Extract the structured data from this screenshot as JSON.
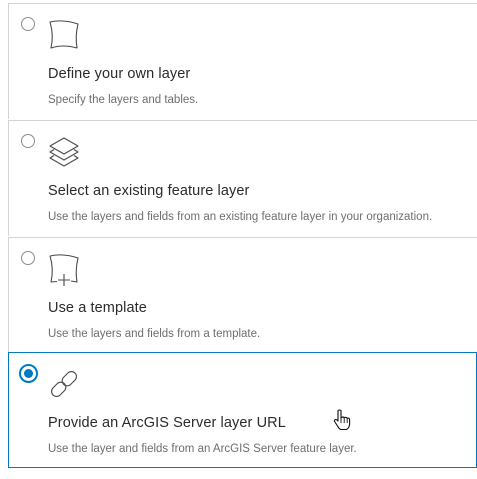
{
  "options": [
    {
      "title": "Define your own layer",
      "description": "Specify the layers and tables.",
      "icon": "layer-shape-icon",
      "selected": false
    },
    {
      "title": "Select an existing feature layer",
      "description": "Use the layers and fields from an existing feature layer in your organization.",
      "icon": "layers-stack-icon",
      "selected": false
    },
    {
      "title": "Use a template",
      "description": "Use the layers and fields from a template.",
      "icon": "layer-add-icon",
      "selected": false
    },
    {
      "title": "Provide an ArcGIS Server layer URL",
      "description": "Use the layer and fields from an ArcGIS Server feature layer.",
      "icon": "link-icon",
      "selected": true
    }
  ],
  "colors": {
    "accent": "#0079c1",
    "border": "#d4d4d4",
    "title_text": "#2b2b2b",
    "description_text": "#6e6e6e",
    "icon_stroke": "#4a4a4a"
  }
}
